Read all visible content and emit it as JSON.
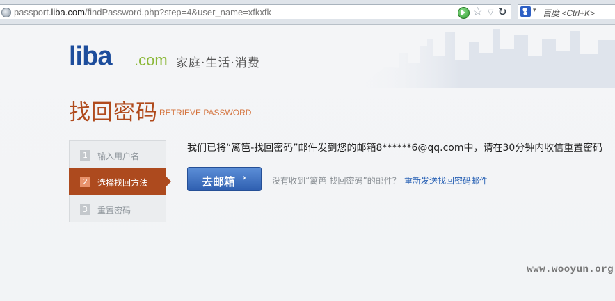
{
  "browser": {
    "url_prefix": "passport.",
    "url_domain": "liba.com",
    "url_path": "/findPassword.php?step=4&user_name=xfkxfk",
    "search_placeholder": "百度 <Ctrl+K>",
    "icons": [
      "globe-icon",
      "go-icon",
      "star-icon",
      "dropdown-icon",
      "reload-icon",
      "baidu-paw-icon"
    ]
  },
  "logo": {
    "brand": "liba",
    "suffix": ".com",
    "slogan": "家庭·生活·消费"
  },
  "title": {
    "cn": "找回密码",
    "en": "RETRIEVE PASSWORD"
  },
  "steps": [
    {
      "num": "1",
      "label": "输入用户名",
      "active": false
    },
    {
      "num": "2",
      "label": "选择找回方法",
      "active": true
    },
    {
      "num": "3",
      "label": "重置密码",
      "active": false
    }
  ],
  "message": "我们已将“篱笆-找回密码”邮件发到您的邮箱8******6@qq.com中，请在30分钟内收信重置密码",
  "mail_button": {
    "label": "去邮箱",
    "chevron": "›"
  },
  "no_receive": "没有收到“篱笆-找回密码”的邮件？",
  "resend_link": "重新发送找回密码邮件",
  "watermark": "www.wooyun.org",
  "colors": {
    "brand_blue": "#1d4d9c",
    "brand_green": "#8cb83a",
    "accent": "#ad4a1e",
    "link": "#2a62b5",
    "button": "#3a6cc0"
  }
}
